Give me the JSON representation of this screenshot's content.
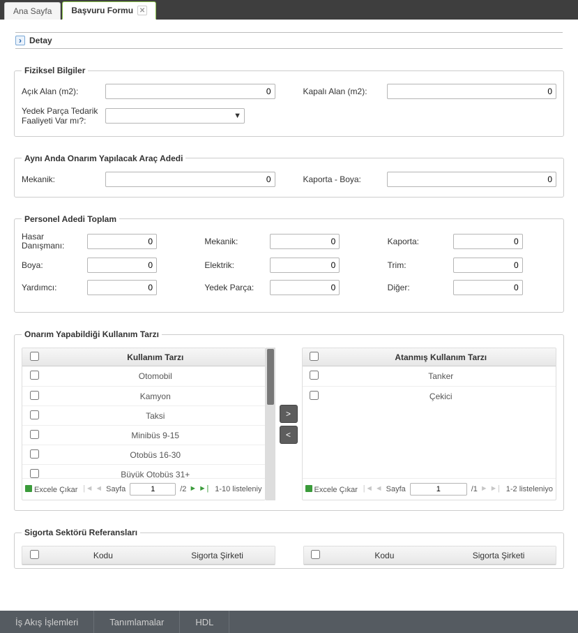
{
  "tabs": {
    "home": "Ana Sayfa",
    "form": "Başvuru Formu"
  },
  "detay": {
    "label": "Detay"
  },
  "fiziksel": {
    "legend": "Fiziksel Bilgiler",
    "acik_alan_label": "Açık Alan (m2):",
    "acik_alan_value": "0",
    "kapali_alan_label": "Kapalı Alan (m2):",
    "kapali_alan_value": "0",
    "yedek_parca_label": "Yedek Parça Tedarik Faaliyeti Var mı?:"
  },
  "onarim_arac": {
    "legend": "Aynı Anda Onarım Yapılacak Araç Adedi",
    "mekanik_label": "Mekanik:",
    "mekanik_value": "0",
    "kaporta_label": "Kaporta - Boya:",
    "kaporta_value": "0"
  },
  "personel": {
    "legend": "Personel Adedi Toplam",
    "hasar_label": "Hasar Danışmanı:",
    "hasar_value": "0",
    "mekanik_label": "Mekanik:",
    "mekanik_value": "0",
    "kaporta_label": "Kaporta:",
    "kaporta_value": "0",
    "boya_label": "Boya:",
    "boya_value": "0",
    "elektrik_label": "Elektrik:",
    "elektrik_value": "0",
    "trim_label": "Trim:",
    "trim_value": "0",
    "yardimci_label": "Yardımcı:",
    "yardimci_value": "0",
    "yedek_label": "Yedek Parça:",
    "yedek_value": "0",
    "diger_label": "Diğer:",
    "diger_value": "0"
  },
  "kullanim": {
    "legend": "Onarım Yapabildiği Kullanım Tarzı",
    "left_title": "Kullanım Tarzı",
    "right_title": "Atanmış Kullanım Tarzı",
    "left": [
      "Otomobil",
      "Kamyon",
      "Taksi",
      "Minibüs 9-15",
      "Otobüs 16-30",
      "Büyük Otobüs 31+"
    ],
    "right": [
      "Tanker",
      "Çekici"
    ],
    "btn_right": ">",
    "btn_left": "<",
    "pager_left": {
      "excel": "Excele Çıkar",
      "page_label": "Sayfa",
      "page": "1",
      "total": "/2",
      "info": "1-10 listeleniy"
    },
    "pager_right": {
      "excel": "Excele Çıkar",
      "page_label": "Sayfa",
      "page": "1",
      "total": "/1",
      "info": "1-2 listeleniyo"
    }
  },
  "sigorta": {
    "legend": "Sigorta Sektörü Referansları",
    "kodu": "Kodu",
    "sirket": "Sigorta Şirketi"
  },
  "bottom_menu": {
    "is_akis": "İş Akış İşlemleri",
    "tanim": "Tanımlamalar",
    "hdl": "HDL"
  }
}
